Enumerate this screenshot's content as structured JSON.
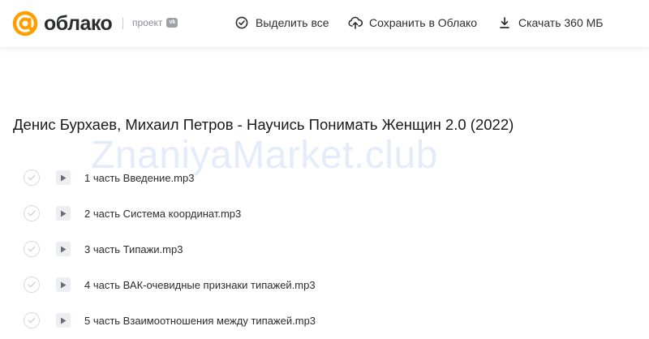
{
  "header": {
    "logo_text": "облако",
    "project_label": "проект",
    "vk_badge": "vk",
    "actions": {
      "select_all": "Выделить все",
      "save_to_cloud": "Сохранить в Облако",
      "download": "Скачать 360 МБ"
    },
    "colors": {
      "brand_orange": "#ff9e00",
      "text": "#2c2d2e",
      "muted": "#8a8d93"
    }
  },
  "folder": {
    "title": "Денис Бурхаев, Михаил Петров - Научись Понимать Женщин 2.0 (2022)"
  },
  "watermark": "ZnaniyaMarket.club",
  "files": [
    {
      "name": "1 часть Введение.mp3"
    },
    {
      "name": "2 часть Система координат.mp3"
    },
    {
      "name": "3 часть Типажи.mp3"
    },
    {
      "name": "4 часть ВАК-очевидные признаки типажей.mp3"
    },
    {
      "name": "5 часть Взаимоотношения между типажей.mp3"
    }
  ]
}
